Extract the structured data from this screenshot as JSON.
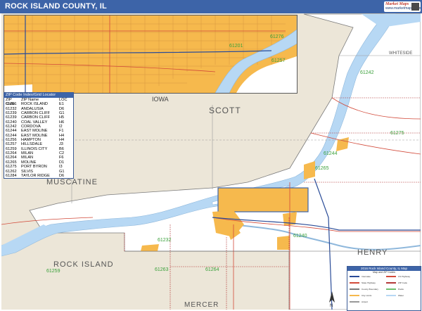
{
  "header": {
    "title": "ROCK ISLAND COUNTY, IL",
    "logo_top": "Market Maps",
    "logo_bottom": "www.marketmaps.com"
  },
  "map": {
    "colors": {
      "water": "#b7d8f4",
      "land": "#ece6d8",
      "county": "#ffffff",
      "urban": "#f6b94d",
      "roads": "#d24a3a",
      "title_bar": "#3d64a8"
    },
    "labels": {
      "iowa": "IOWA",
      "scott": "SCOTT",
      "muscatine": "MUSCATINE",
      "rock_island": "ROCK ISLAND",
      "henry": "HENRY",
      "mercer": "MERCER",
      "whiteside": "WHITESIDE"
    },
    "zip_labels": [
      "61242",
      "61232",
      "61275",
      "61244",
      "61265",
      "61240",
      "61259",
      "61263",
      "61264",
      "61276",
      "61201",
      "61257"
    ]
  },
  "zip_locator": {
    "header": "ZIP Code Index/Grid Locator",
    "columns": [
      "ZIP Code",
      "ZIP Name",
      "LOC"
    ],
    "rows": [
      [
        "61201",
        "ROCK ISLAND",
        "E1"
      ],
      [
        "61232",
        "ANDALUSIA",
        "D6"
      ],
      [
        "61239",
        "CARBON CLIFF",
        "G1"
      ],
      [
        "61239",
        "CARBON CLIFF",
        "H5"
      ],
      [
        "61240",
        "COAL VALLEY",
        "H6"
      ],
      [
        "61242",
        "CORDOVA",
        "I2"
      ],
      [
        "61244",
        "EAST MOLINE",
        "F1"
      ],
      [
        "61244",
        "EAST MOLINE",
        "H4"
      ],
      [
        "61256",
        "HAMPTON",
        "H4"
      ],
      [
        "61257",
        "HILLSDALE",
        "J3"
      ],
      [
        "61259",
        "ILLINOIS CITY",
        "B6"
      ],
      [
        "61264",
        "MILAN",
        "C2"
      ],
      [
        "61264",
        "MILAN",
        "F6"
      ],
      [
        "61265",
        "MOLINE",
        "D1"
      ],
      [
        "61275",
        "PORT BYRON",
        "I3"
      ],
      [
        "61262",
        "SILVIS",
        "G1"
      ],
      [
        "61284",
        "TAYLOR RIDGE",
        "D6"
      ]
    ]
  },
  "legend": {
    "title": "2016 Rock Island County, IL Map",
    "subtitle": "Map and ZIP Codes",
    "items": [
      "Interstate",
      "US Highway",
      "State Highway",
      "ZIP Code",
      "County Boundary",
      "Parks",
      "City Limits",
      "Water",
      "Airport"
    ]
  }
}
